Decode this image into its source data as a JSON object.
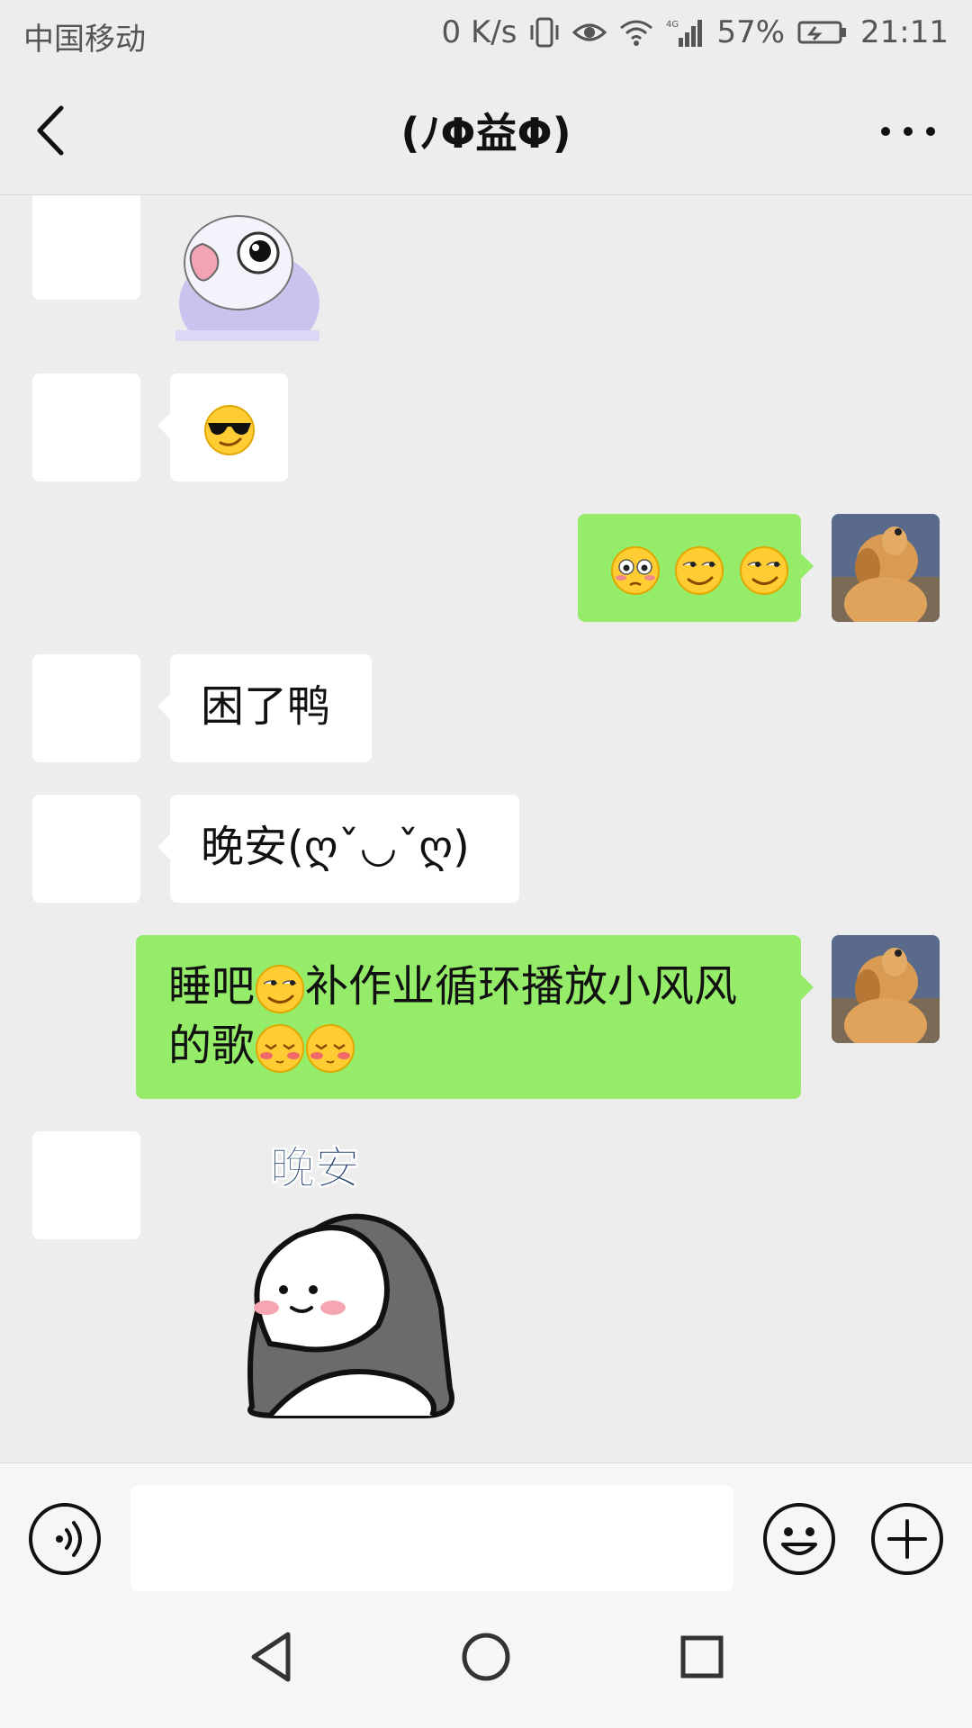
{
  "status_bar": {
    "carrier": "中国移动",
    "net_speed": "0 K/s",
    "network": "4G",
    "battery": "57%",
    "time": "21:11"
  },
  "nav": {
    "title": "(ﾉΦ益Φ)",
    "back_icon": "chevron-left-icon",
    "more_icon": "more-dots-icon"
  },
  "messages": [
    {
      "side": "in",
      "type": "sticker",
      "sticker": "parrot"
    },
    {
      "side": "in",
      "type": "text",
      "text": "",
      "emoji": [
        "sunglasses-face"
      ]
    },
    {
      "side": "out",
      "type": "text",
      "text": "",
      "emoji": [
        "flushed-face",
        "smirk-face",
        "smirk-face"
      ]
    },
    {
      "side": "in",
      "type": "text",
      "text": "困了鸭"
    },
    {
      "side": "in",
      "type": "text",
      "text": "晚安(ღˇ◡ˇღ)"
    },
    {
      "side": "out",
      "type": "text",
      "line1_a": "睡吧",
      "line1_b": "补作业循环播放小风风",
      "line2": "的歌"
    },
    {
      "side": "in",
      "type": "sticker",
      "sticker": "blanket-bun",
      "sticker_text": "晚安"
    }
  ],
  "input_bar": {
    "voice_icon": "voice-icon",
    "placeholder": "",
    "emoji_icon": "emoji-icon",
    "plus_icon": "plus-icon"
  },
  "colors": {
    "background": "#ededed",
    "outgoing_bubble": "#95ec69",
    "incoming_bubble": "#ffffff"
  }
}
